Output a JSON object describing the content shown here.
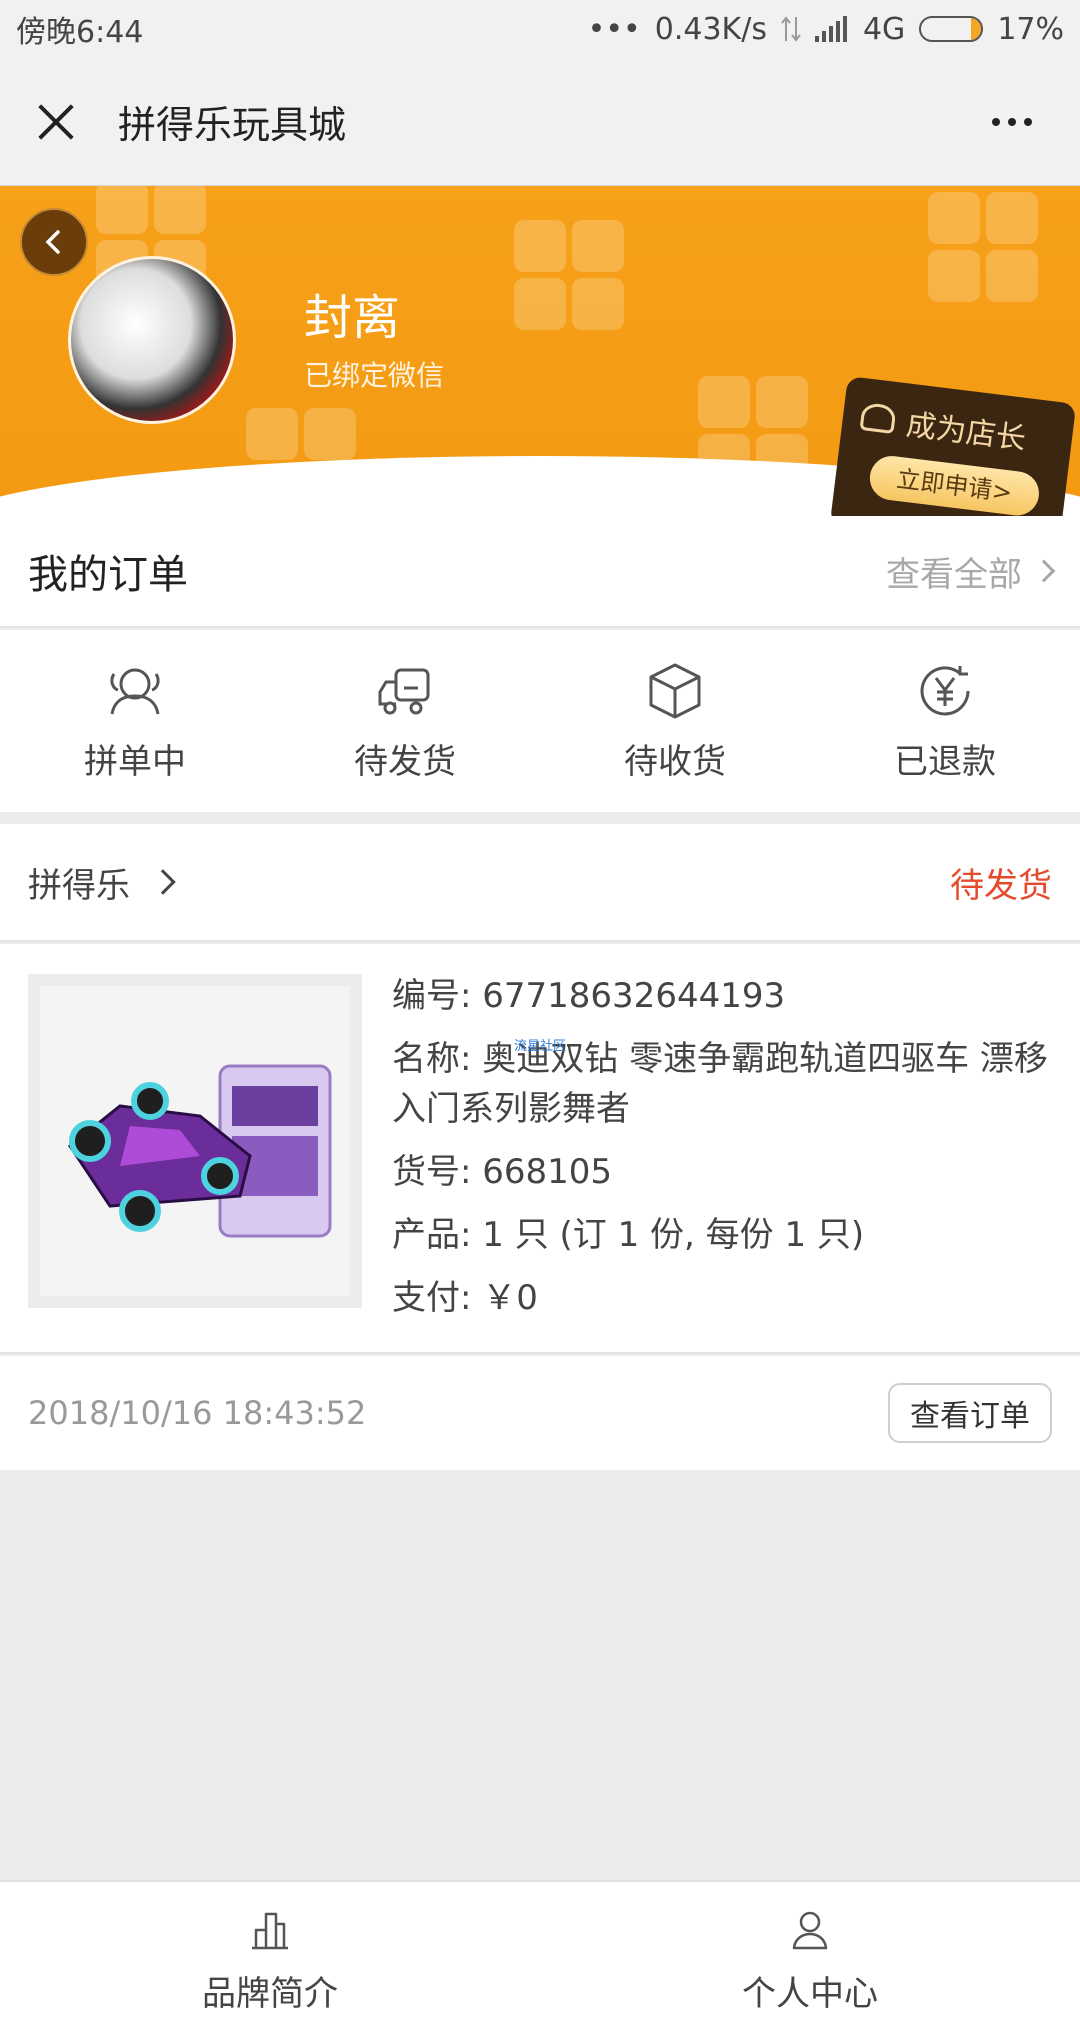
{
  "status_bar": {
    "time": "傍晚6:44",
    "dots": "•••",
    "network_speed": "0.43K/s",
    "network_type": "4G",
    "battery_percent": "17%",
    "battery_level": 0.17
  },
  "nav": {
    "title": "拼得乐玩具城"
  },
  "profile": {
    "user_name": "封离",
    "binding_status": "已绑定微信",
    "shopkeeper_title": "成为店长",
    "apply_label": "立即申请>"
  },
  "orders": {
    "title": "我的订单",
    "view_all": "查看全部",
    "tabs": [
      {
        "label": "拼单中",
        "icon": "group-icon"
      },
      {
        "label": "待发货",
        "icon": "truck-icon"
      },
      {
        "label": "待收货",
        "icon": "box-icon"
      },
      {
        "label": "已退款",
        "icon": "yen-refund-icon"
      }
    ]
  },
  "order_card": {
    "shop_name": "拼得乐",
    "status": "待发货",
    "number": "编号: 67718632644193",
    "watermark": "流星社区",
    "name": "名称: 奥迪双钻 零速争霸跑轨道四驱车 漂移入门系列影舞者",
    "item_no": "货号: 668105",
    "product": "产品: 1 只 (订 1 份, 每份 1 只)",
    "payment": "支付: ￥0",
    "time": "2018/10/16 18:43:52",
    "view_order": "查看订单"
  },
  "bottom_nav": {
    "items": [
      {
        "label": "品牌简介",
        "icon": "building-icon"
      },
      {
        "label": "个人中心",
        "icon": "person-icon"
      }
    ]
  },
  "colors": {
    "banner": "#f39a12",
    "status_red": "#e64a2c",
    "card_dark": "#3b2612"
  }
}
